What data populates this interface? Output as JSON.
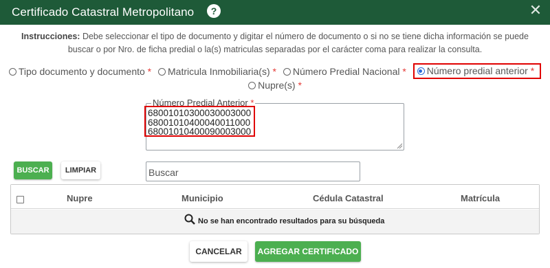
{
  "dialog": {
    "title": "Certificado Catastral Metropolitano",
    "help_icon": "?",
    "close_icon": "✕"
  },
  "instructions": {
    "label": "Instrucciones:",
    "text": "Debe seleccionar el tipo de documento y digitar el número de documento o si no se tiene dicha información se puede buscar o por Nro. de ficha predial o la(s) matriculas separadas por el carácter coma para realizar la consulta."
  },
  "search_types": [
    {
      "label": "Tipo documento y documento",
      "required": "*",
      "selected": false
    },
    {
      "label": "Matricula Inmobiliaria(s)",
      "required": "*",
      "selected": false
    },
    {
      "label": "Número Predial Nacional",
      "required": "*",
      "selected": false
    },
    {
      "label": "Número predial anterior",
      "required": "*",
      "selected": true
    },
    {
      "label": "Nupre(s)",
      "required": "*",
      "selected": false
    }
  ],
  "textarea": {
    "label": "Número Predial Anterior",
    "required": "*",
    "lines": [
      "68001010300030003000",
      "68001010400040011000",
      "68001010400090003000"
    ]
  },
  "actions": {
    "search_label": "BUSCAR",
    "clear_label": "LIMPIAR",
    "search_placeholder": "Buscar"
  },
  "table": {
    "columns": [
      "Nupre",
      "Municipio",
      "Cédula Catastral",
      "Matrícula"
    ],
    "empty_message": "No se han encontrado resultados para su búsqueda"
  },
  "footer": {
    "cancel_label": "CANCELAR",
    "add_label": "AGREGAR CERTIFICADO"
  },
  "colors": {
    "header_bg": "#1e5a38",
    "primary_button": "#4caf50",
    "highlight_border": "#e00000",
    "required": "#e53935",
    "radio_selected": "#2a6ad8"
  }
}
